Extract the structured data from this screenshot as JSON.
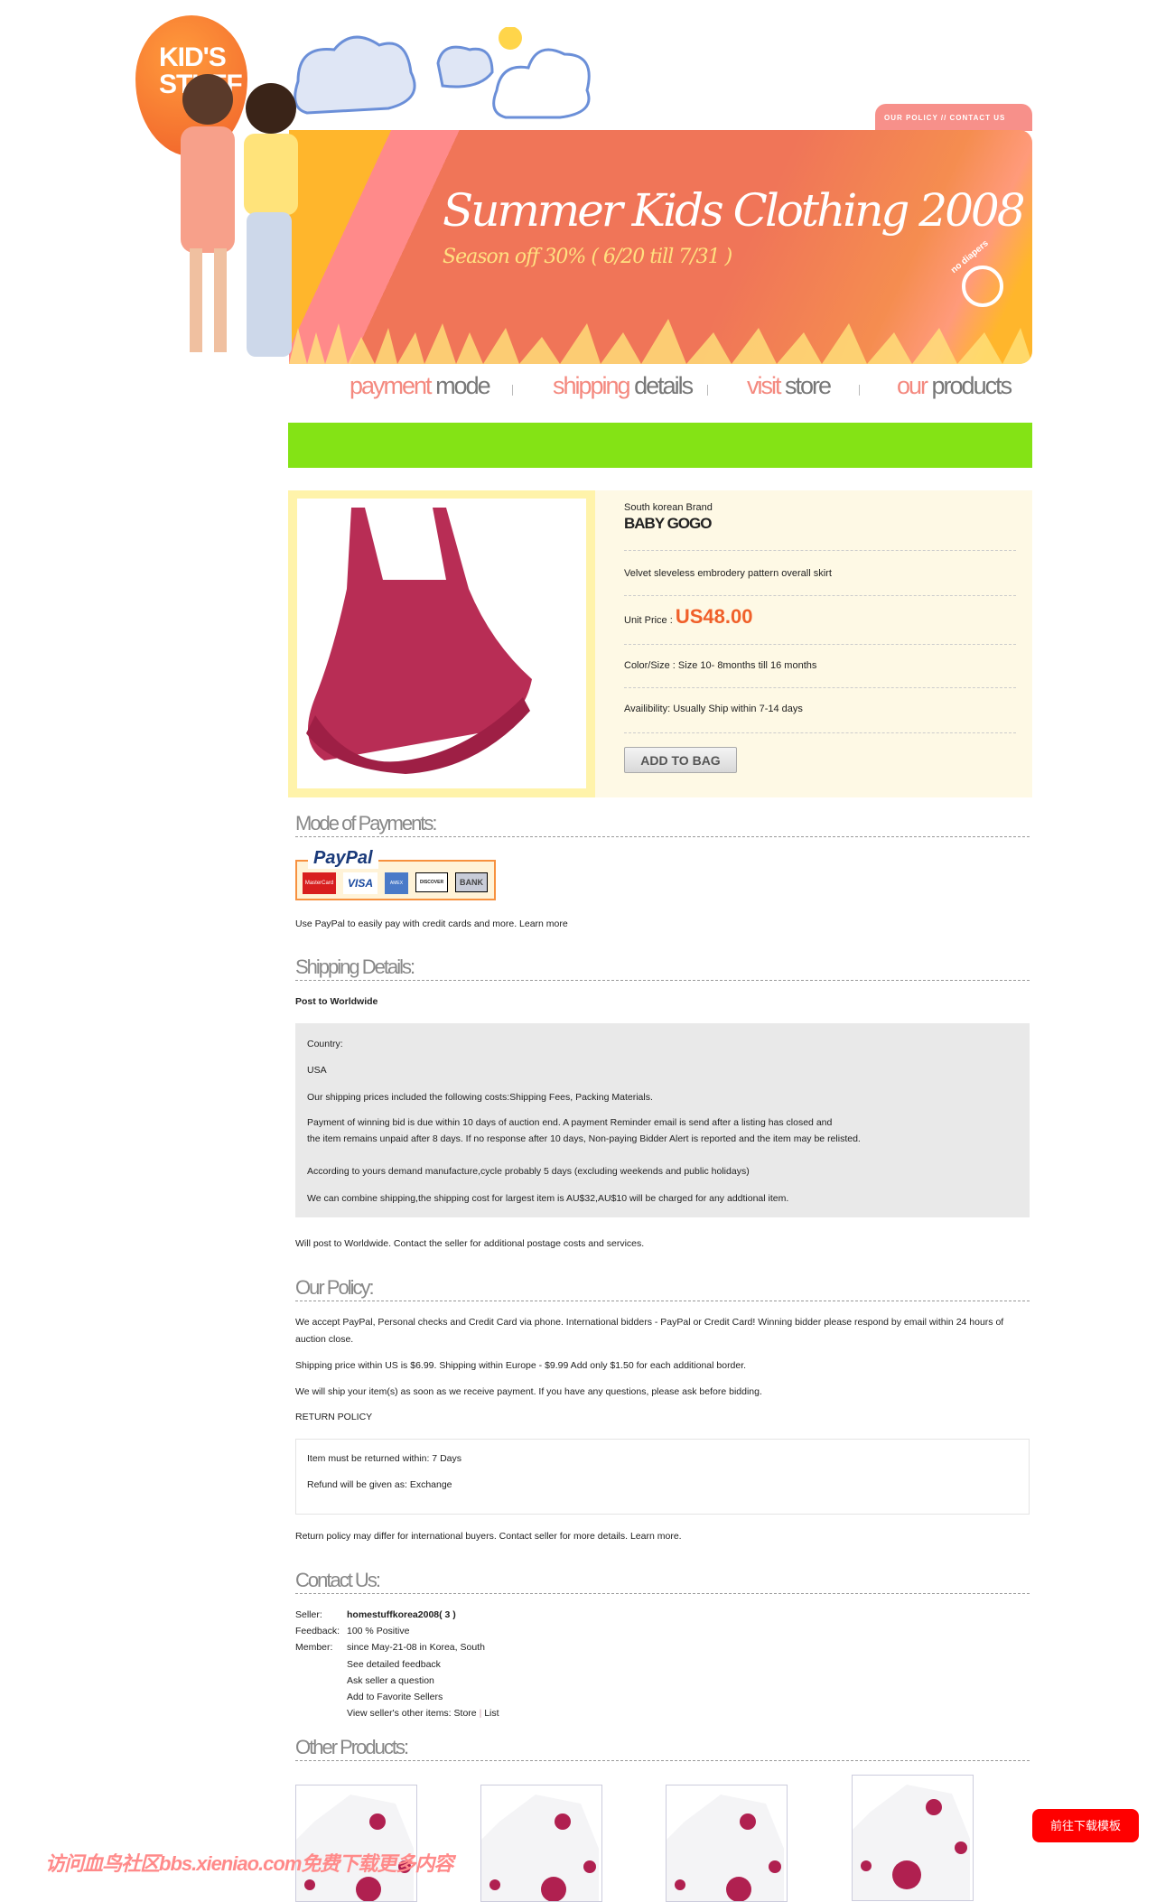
{
  "header": {
    "logo_text": "KID'S STUFF",
    "top_links": "OUR POLICY // CONTACT US",
    "banner_title": "Summer Kids Clothing 2008",
    "banner_subtitle": "Season off 30% ( 6/20 till 7/31 )",
    "badge": "no diapers"
  },
  "nav": [
    {
      "accent": "payment",
      "rest": " mode"
    },
    {
      "accent": "shipping",
      "rest": " details"
    },
    {
      "accent": "visit",
      "rest": " store"
    },
    {
      "accent": "our",
      "rest": " products"
    }
  ],
  "product": {
    "brand_label": "South korean Brand",
    "brand": "BABY GOGO",
    "description": "Velvet sleveless embrodery pattern overall skirt",
    "price_label": "Unit Price :",
    "price": "US48.00",
    "color_size": "Color/Size : Size 10- 8months till 16 months",
    "availability": "Availibility: Usually Ship within 7-14 days",
    "add_to_bag": "ADD TO BAG",
    "price_color": "#f0602a"
  },
  "payments": {
    "heading": "Mode of Payments:",
    "logo": "PayPal",
    "cards": [
      "MasterCard",
      "VISA",
      "AMEX",
      "DISCOVER",
      "BANK"
    ],
    "text": "Use PayPal to easily pay with credit cards and more. Learn more"
  },
  "shipping": {
    "heading": "Shipping Details:",
    "post": "Post to Worldwide",
    "lines": [
      "Country:",
      "USA",
      "Our shipping prices included the following costs:Shipping Fees, Packing Materials.",
      "Payment of winning bid is due within 10 days of auction end. A payment Reminder email is send after a listing has closed and",
      "the item remains unpaid after 8 days. If no response after 10 days, Non-paying Bidder Alert is reported and the item may be relisted.",
      "According to yours demand manufacture,cycle probably 5 days (excluding weekends and public holidays)",
      "We can combine shipping,the shipping cost for largest item is AU$32,AU$10 will be charged for any addtional item."
    ],
    "footer": "Will post to Worldwide. Contact the seller for additional postage costs and services."
  },
  "policy": {
    "heading": "Our Policy:",
    "lines": [
      "We accept PayPal, Personal checks and Credit Card via phone. International bidders - PayPal or Credit Card! Winning bidder please respond by email within 24 hours of",
      "auction close.",
      "Shipping price within US is $6.99. Shipping within Europe - $9.99 Add only $1.50 for each additional border.",
      "We will ship your item(s) as soon as we receive payment. If you have any questions, please ask before bidding."
    ],
    "return_heading": "RETURN POLICY",
    "return_lines": [
      "Item must be returned within: 7 Days",
      "Refund will be given as: Exchange"
    ],
    "footer": "Return policy may differ for international buyers. Contact seller for more details. Learn more."
  },
  "contact": {
    "heading": "Contact Us:",
    "seller_label": "Seller:",
    "seller": "homestuffkorea2008( 3 )",
    "feedback_label": "Feedback:",
    "feedback": "100 % Positive",
    "member_label": "Member:",
    "member": "since May-21-08 in Korea, South",
    "links": [
      "See detailed feedback",
      "Ask seller a question",
      "Add to Favorite Sellers"
    ],
    "other_items": "View seller's other items:",
    "store": "Store",
    "sep": "|",
    "list": "List"
  },
  "other": {
    "heading": "Other Products:"
  },
  "watermark": "访问血鸟社区bbs.xieniao.com免费下载更多内容",
  "download_button": "前往下载模板"
}
